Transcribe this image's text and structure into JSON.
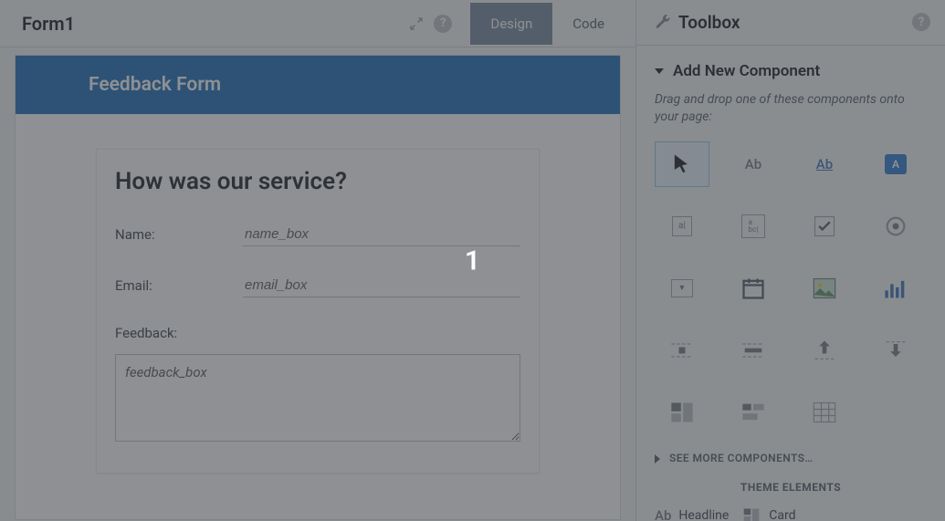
{
  "left": {
    "title": "Form1",
    "tabs": {
      "design": "Design",
      "code": "Code",
      "active": "design"
    }
  },
  "form": {
    "header": "Feedback Form",
    "heading": "How was our service?",
    "name_label": "Name:",
    "name_placeholder": "name_box",
    "email_label": "Email:",
    "email_placeholder": "email_box",
    "feedback_label": "Feedback:",
    "feedback_placeholder": "feedback_box"
  },
  "right": {
    "title": "Toolbox",
    "section": "Add New Component",
    "hint": "Drag and drop one of these components onto your page:",
    "ab": "Ab",
    "button_letter": "A",
    "see_more": "SEE MORE COMPONENTS…",
    "theme_label": "THEME ELEMENTS",
    "headline": "Headline",
    "card": "Card"
  },
  "overlay": {
    "number": "1"
  }
}
